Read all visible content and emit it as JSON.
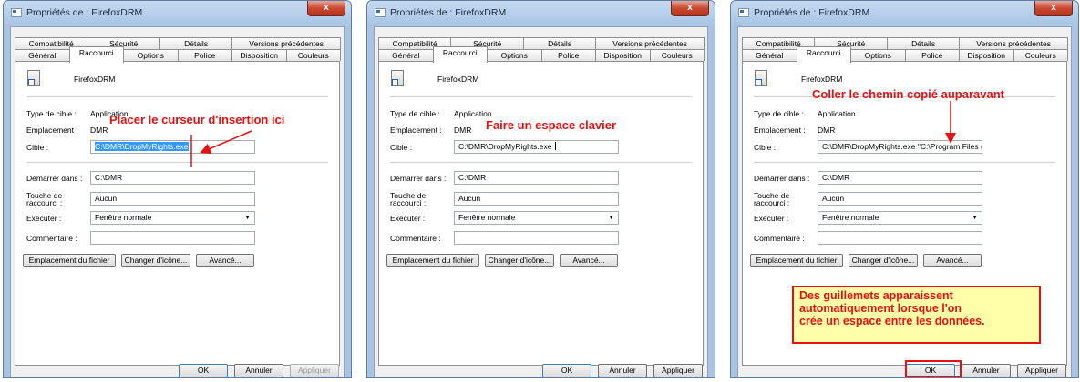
{
  "window_title": "Propriétés de : FirefoxDRM",
  "close_glyph": "x",
  "tabs_row1": [
    "Compatibilité",
    "Sécurité",
    "Détails",
    "Versions précédentes"
  ],
  "tabs_row2": [
    "Général",
    "Raccourci",
    "Options",
    "Police",
    "Disposition",
    "Couleurs"
  ],
  "active_tab": "Raccourci",
  "labels": {
    "app_name": "FirefoxDRM",
    "type_label": "Type de cible :",
    "type_value": "Application",
    "location_label": "Emplacement :",
    "location_value": "DMR",
    "target_label": "Cible :",
    "start_label": "Démarrer dans :",
    "start_value": "C:\\DMR",
    "hotkey_label_1": "Touche de",
    "hotkey_label_2": "raccourci :",
    "hotkey_value": "Aucun",
    "run_label": "Exécuter :",
    "run_value": "Fenêtre normale",
    "comment_label": "Commentaire :",
    "open_location_button": "Emplacement du fichier",
    "change_icon_button": "Changer d'icône...",
    "advanced_button": "Avancé...",
    "ok_button": "OK",
    "cancel_button": "Annuler",
    "apply_button": "Appliquer"
  },
  "panels": [
    {
      "target_value": "C:\\DMR\\DropMyRights.exe",
      "target_selected": true,
      "apply_enabled": false,
      "annotation": "Placer le curseur d'insertion ici"
    },
    {
      "target_value": "C:\\DMR\\DropMyRights.exe ",
      "target_selected": false,
      "apply_enabled": true,
      "annotation": "Faire un espace clavier"
    },
    {
      "target_value": "C:\\DMR\\DropMyRights.exe \"C:\\Program Files (",
      "target_selected": false,
      "apply_enabled": true,
      "annotation": "Coller le chemin copié auparavant"
    }
  ],
  "callout_lines": [
    "Des guillemets apparaissent",
    "automatiquement lorsque l'on",
    "crée un espace entre les données."
  ],
  "colors": {
    "annotation": "#e81010",
    "callout_bg": "#ffffaa",
    "selection": "#3399ff",
    "titlebar": "#a9c6e6",
    "close_button": "#c74a32"
  },
  "icons": [
    "shortcut-app-icon",
    "window-icon",
    "close-icon",
    "dropdown-arrow-icon"
  ]
}
